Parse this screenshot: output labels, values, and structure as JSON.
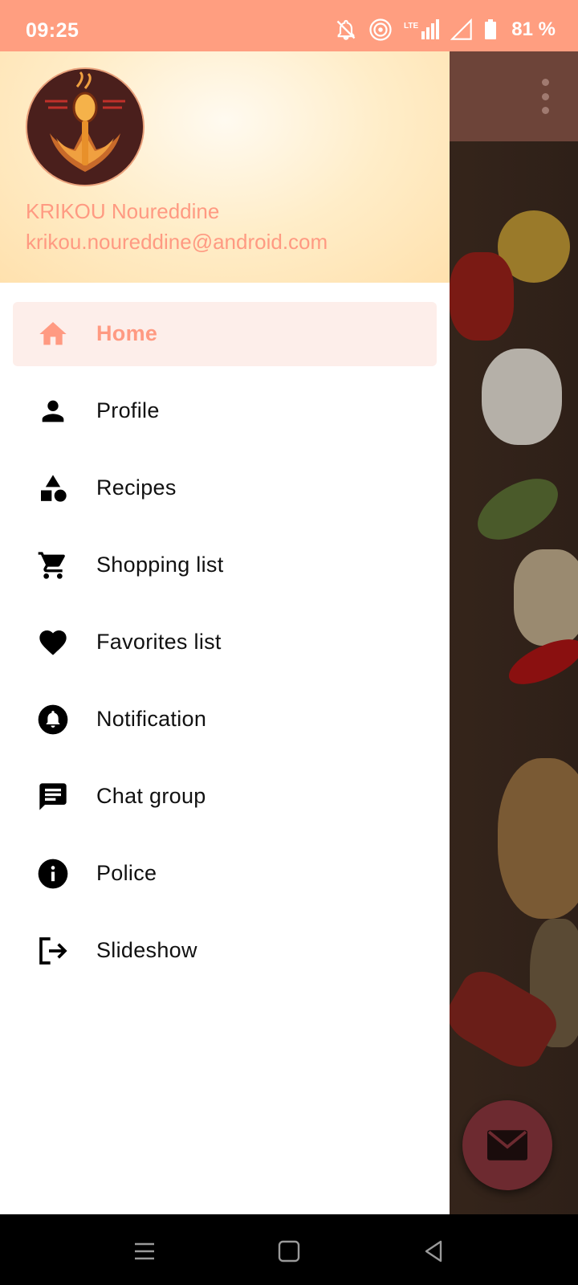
{
  "status_bar": {
    "time": "09:25",
    "battery": "81 %",
    "icons": [
      "bell-off-icon",
      "hotspot-icon",
      "lte-signal-icon",
      "signal-icon",
      "battery-icon"
    ]
  },
  "drawer": {
    "user": {
      "name": "KRIKOU Noureddine",
      "email": "krikou.noureddine@android.com"
    },
    "items": [
      {
        "label": "Home",
        "icon": "home-icon",
        "active": true
      },
      {
        "label": "Profile",
        "icon": "person-icon",
        "active": false
      },
      {
        "label": "Recipes",
        "icon": "category-icon",
        "active": false
      },
      {
        "label": "Shopping list",
        "icon": "cart-icon",
        "active": false
      },
      {
        "label": "Favorites list",
        "icon": "heart-icon",
        "active": false
      },
      {
        "label": "Notification",
        "icon": "bell-icon",
        "active": false
      },
      {
        "label": "Chat group",
        "icon": "chat-icon",
        "active": false
      },
      {
        "label": "Police",
        "icon": "info-icon",
        "active": false
      },
      {
        "label": "Slideshow",
        "icon": "logout-icon",
        "active": false
      }
    ]
  },
  "colors": {
    "accent": "#ff9a82",
    "status_bar": "#ff9e80",
    "toolbar": "#6d4439",
    "fab": "#6d2a30",
    "active_item_bg": "#fdeeea"
  }
}
